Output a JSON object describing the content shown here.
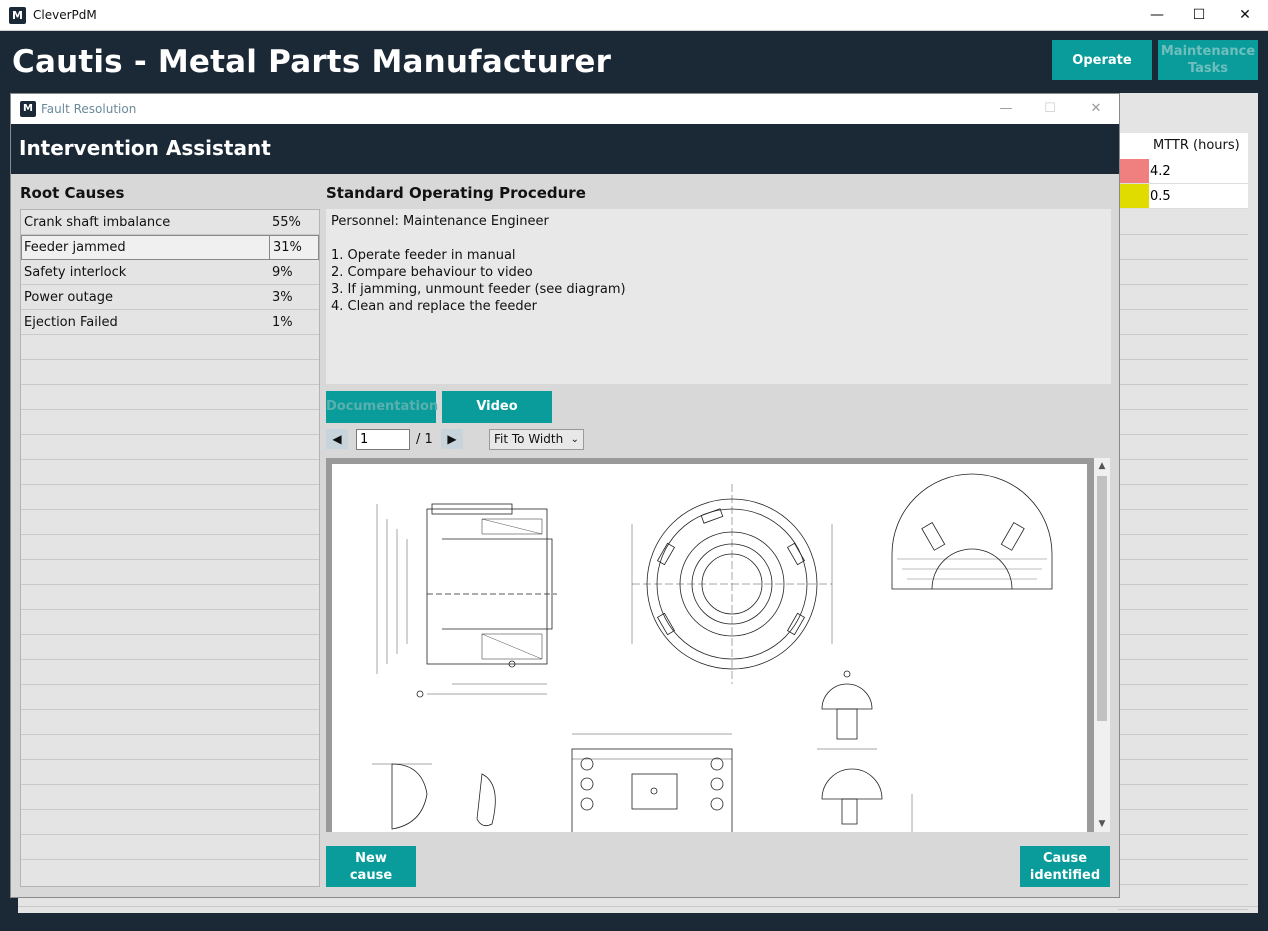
{
  "window": {
    "title": "CleverPdM",
    "logo_letter": "M",
    "minimize": "—",
    "maximize": "☐",
    "close": "✕"
  },
  "app": {
    "title": "Cautis - Metal Parts Manufacturer",
    "operate_label": "Operate",
    "maintenance_label": "Maintenance Tasks"
  },
  "background_table": {
    "header": "MTTR (hours)",
    "rows": [
      {
        "value": "4.2",
        "color": "#f08080"
      },
      {
        "value": "0.5",
        "color": "#e0dc00"
      }
    ]
  },
  "dialog": {
    "title": "Fault Resolution",
    "header": "Intervention Assistant",
    "root_causes_title": "Root Causes",
    "sop_title": "Standard Operating Procedure",
    "root_causes": [
      {
        "name": "Crank shaft imbalance",
        "pct": "55%"
      },
      {
        "name": "Feeder jammed",
        "pct": "31%"
      },
      {
        "name": "Safety interlock",
        "pct": "9%"
      },
      {
        "name": "Power outage",
        "pct": "3%"
      },
      {
        "name": "Ejection Failed",
        "pct": "1%"
      }
    ],
    "sop_lines": [
      "Personnel: Maintenance Engineer",
      "",
      "1. Operate feeder in manual",
      "2. Compare behaviour to video",
      "3. If jamming, unmount feeder (see diagram)",
      "4. Clean and replace the feeder"
    ],
    "tabs": {
      "documentation": "Documentation",
      "video": "Video"
    },
    "viewer": {
      "page_value": "1",
      "page_total": "/ 1",
      "zoom": "Fit To Width",
      "prev": "◀",
      "next": "▶"
    },
    "buttons": {
      "new_cause": "New cause",
      "cause_identified": "Cause identified"
    }
  }
}
